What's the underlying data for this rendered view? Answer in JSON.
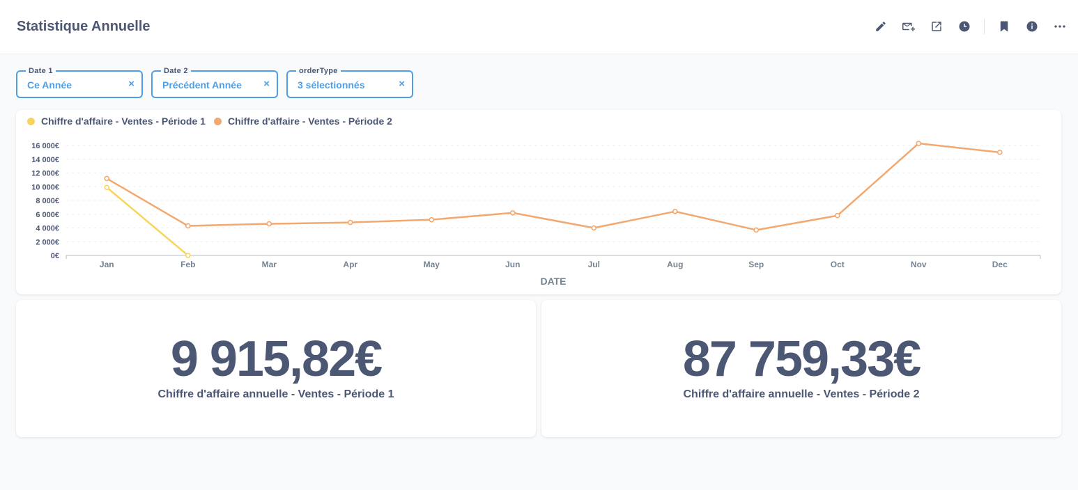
{
  "header": {
    "title": "Statistique Annuelle",
    "actions": [
      "edit-icon",
      "subscribe-mail-icon",
      "share-icon",
      "history-icon",
      "bookmark-icon",
      "info-icon",
      "more-icon"
    ]
  },
  "filters": [
    {
      "label": "Date 1",
      "value": "Ce Année",
      "clear": "×"
    },
    {
      "label": "Date 2",
      "value": "Précédent Année",
      "clear": "×"
    },
    {
      "label": "orderType",
      "value": "3 sélectionnés",
      "clear": "×"
    }
  ],
  "chart_data": {
    "type": "line",
    "categories": [
      "Jan",
      "Feb",
      "Mar",
      "Apr",
      "May",
      "Jun",
      "Jul",
      "Aug",
      "Sep",
      "Oct",
      "Nov",
      "Dec"
    ],
    "series": [
      {
        "name": "Chiffre d'affaire - Ventes - Période 1",
        "color": "#f9d45c",
        "values": [
          9900,
          0
        ]
      },
      {
        "name": "Chiffre d'affaire - Ventes - Période 2",
        "color": "#f2a86f",
        "values": [
          11200,
          4300,
          4600,
          4800,
          5200,
          6200,
          4000,
          6400,
          3700,
          5800,
          16300,
          15000
        ]
      }
    ],
    "yticks": [
      "0€",
      "2 000€",
      "4 000€",
      "6 000€",
      "8 000€",
      "10 000€",
      "12 000€",
      "14 000€",
      "16 000€"
    ],
    "ylim": [
      0,
      16000
    ],
    "xlabel": "DATE",
    "ylabel": "",
    "legend_position": "top-left",
    "grid": true
  },
  "kpis": [
    {
      "value": "9 915,82€",
      "label": "Chiffre d'affaire annuelle - Ventes - Période 1"
    },
    {
      "value": "87 759,33€",
      "label": "Chiffre d'affaire annuelle - Ventes - Période 2"
    }
  ]
}
